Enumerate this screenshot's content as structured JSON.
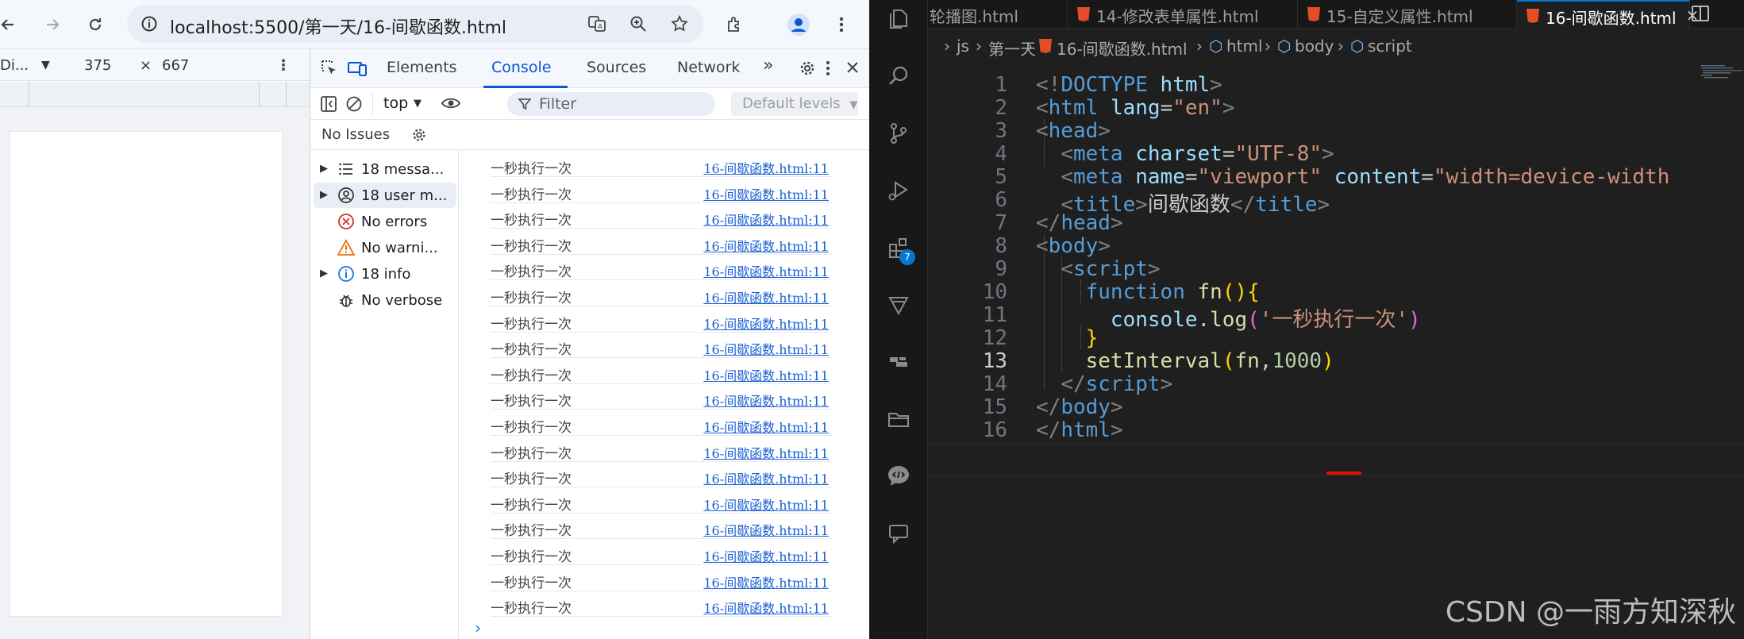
{
  "browser": {
    "url": "localhost:5500/第一天/16-间歇函数.html",
    "device": {
      "name": "Di...",
      "width": "375",
      "times": "×",
      "height": "667"
    }
  },
  "devtools": {
    "tabs": [
      "Elements",
      "Console",
      "Sources",
      "Network"
    ],
    "active_tab": "Console",
    "more": "»",
    "context": "top",
    "filter_placeholder": "Filter",
    "levels": "Default levels",
    "issues": "No Issues",
    "sidebar": [
      {
        "label": "18 messa...",
        "icon": "list-icon",
        "expandable": true
      },
      {
        "label": "18 user m...",
        "icon": "user-icon",
        "expandable": true,
        "selected": true
      },
      {
        "label": "No errors",
        "icon": "error-icon",
        "expandable": false
      },
      {
        "label": "No warni...",
        "icon": "warning-icon",
        "expandable": false
      },
      {
        "label": "18 info",
        "icon": "info-icon",
        "expandable": true
      },
      {
        "label": "No verbose",
        "icon": "bug-icon",
        "expandable": false
      }
    ],
    "log_message": "一秒执行一次",
    "log_source": "16-间歇函数.html:11",
    "log_count": 18,
    "prompt": "›"
  },
  "editor": {
    "tabs": [
      {
        "label": "轮播图.html",
        "active": false
      },
      {
        "label": "14-修改表单属性.html",
        "active": false
      },
      {
        "label": "15-自定义属性.html",
        "active": false
      },
      {
        "label": "16-间歇函数.html",
        "active": true
      }
    ],
    "close": "×",
    "breadcrumbs": [
      "js",
      "第一天",
      "16-间歇函数.html",
      "html",
      "body",
      "script"
    ],
    "badge": "7",
    "current_line": 13,
    "lines": [
      [
        [
          "tag",
          "<!"
        ],
        [
          "name",
          "DOCTYPE "
        ],
        [
          "attr",
          "html"
        ],
        [
          "tag",
          ">"
        ]
      ],
      [
        [
          "tag",
          "<"
        ],
        [
          "name",
          "html "
        ],
        [
          "attr",
          "lang"
        ],
        [
          "txt",
          "="
        ],
        [
          "str",
          "\"en\""
        ],
        [
          "tag",
          ">"
        ]
      ],
      [
        [
          "tag",
          "<"
        ],
        [
          "name",
          "head"
        ],
        [
          "tag",
          ">"
        ]
      ],
      [
        [
          "txt",
          "  "
        ],
        [
          "tag",
          "<"
        ],
        [
          "name",
          "meta "
        ],
        [
          "attr",
          "charset"
        ],
        [
          "txt",
          "="
        ],
        [
          "str",
          "\"UTF-8\""
        ],
        [
          "tag",
          ">"
        ]
      ],
      [
        [
          "txt",
          "  "
        ],
        [
          "tag",
          "<"
        ],
        [
          "name",
          "meta "
        ],
        [
          "attr",
          "name"
        ],
        [
          "txt",
          "="
        ],
        [
          "str",
          "\"viewport\" "
        ],
        [
          "attr",
          "content"
        ],
        [
          "txt",
          "="
        ],
        [
          "str",
          "\"width=device-width"
        ]
      ],
      [
        [
          "txt",
          "  "
        ],
        [
          "tag",
          "<"
        ],
        [
          "name",
          "title"
        ],
        [
          "tag",
          ">"
        ],
        [
          "txt",
          "间歇函数"
        ],
        [
          "tag",
          "</"
        ],
        [
          "name",
          "title"
        ],
        [
          "tag",
          ">"
        ]
      ],
      [
        [
          "tag",
          "</"
        ],
        [
          "name",
          "head"
        ],
        [
          "tag",
          ">"
        ]
      ],
      [
        [
          "tag",
          "<"
        ],
        [
          "name",
          "body"
        ],
        [
          "tag",
          ">"
        ]
      ],
      [
        [
          "txt",
          "  "
        ],
        [
          "tag",
          "<"
        ],
        [
          "name",
          "script"
        ],
        [
          "tag",
          ">"
        ]
      ],
      [
        [
          "txt",
          "    "
        ],
        [
          "kw",
          "function "
        ],
        [
          "fn",
          "fn"
        ],
        [
          "br1",
          "(){"
        ]
      ],
      [
        [
          "txt",
          "      "
        ],
        [
          "attr",
          "console"
        ],
        [
          "txt",
          "."
        ],
        [
          "fn",
          "log"
        ],
        [
          "br2",
          "("
        ],
        [
          "str",
          "'一秒执行一次'"
        ],
        [
          "br2",
          ")"
        ]
      ],
      [
        [
          "txt",
          "    "
        ],
        [
          "br1",
          "}"
        ]
      ],
      [
        [
          "txt",
          "    "
        ],
        [
          "fn",
          "setInterval"
        ],
        [
          "br1",
          "("
        ],
        [
          "fn",
          "fn"
        ],
        [
          "txt",
          ","
        ],
        [
          "num",
          "1000"
        ],
        [
          "br1",
          ")"
        ]
      ],
      [
        [
          "txt",
          "  "
        ],
        [
          "tag",
          "</"
        ],
        [
          "name",
          "script"
        ],
        [
          "tag",
          ">"
        ]
      ],
      [
        [
          "tag",
          "</"
        ],
        [
          "name",
          "body"
        ],
        [
          "tag",
          ">"
        ]
      ],
      [
        [
          "tag",
          "</"
        ],
        [
          "name",
          "html"
        ],
        [
          "tag",
          ">"
        ]
      ]
    ],
    "watermark": "CSDN @一雨方知深秋"
  }
}
